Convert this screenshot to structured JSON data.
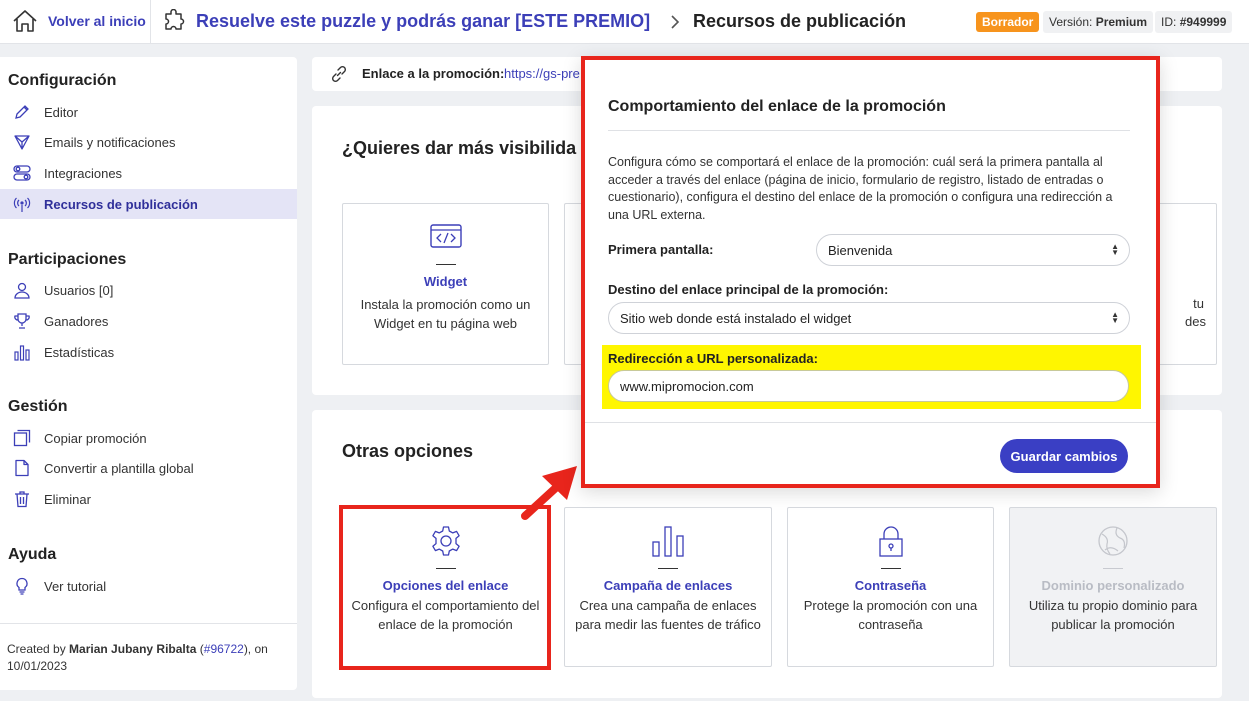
{
  "header": {
    "home_label": "Volver al inicio",
    "promo_title": "Resuelve este puzzle y podrás ganar [ESTE PREMIO]",
    "current_page": "Recursos de publicación",
    "status_badge": "Borrador",
    "version_label": "Versión:",
    "version_value": "Premium",
    "id_label": "ID:",
    "id_value": "#949999",
    "status_color": "#f7941d"
  },
  "sidebar": {
    "sections": [
      {
        "title": "Configuración",
        "items": [
          {
            "label": "Editor",
            "icon": "pencil-icon"
          },
          {
            "label": "Emails y notificaciones",
            "icon": "send-icon"
          },
          {
            "label": "Integraciones",
            "icon": "toggles-icon"
          },
          {
            "label": "Recursos de publicación",
            "icon": "broadcast-icon",
            "active": true
          }
        ]
      },
      {
        "title": "Participaciones",
        "items": [
          {
            "label": "Usuarios [0]",
            "icon": "user-icon"
          },
          {
            "label": "Ganadores",
            "icon": "trophy-icon"
          },
          {
            "label": "Estadísticas",
            "icon": "bar-chart-icon"
          }
        ]
      },
      {
        "title": "Gestión",
        "items": [
          {
            "label": "Copiar promoción",
            "icon": "copy-icon"
          },
          {
            "label": "Convertir a plantilla global",
            "icon": "document-icon"
          },
          {
            "label": "Eliminar",
            "icon": "trash-icon"
          }
        ]
      },
      {
        "title": "Ayuda",
        "items": [
          {
            "label": "Ver tutorial",
            "icon": "lightbulb-icon"
          }
        ]
      }
    ],
    "created_prefix": "Created by",
    "created_author": "Marian Jubany Ribalta",
    "created_id_open": "(",
    "created_id": "#96722",
    "created_suffix": "), on",
    "created_date": "10/01/2023"
  },
  "link_bar": {
    "label": "Enlace a la promoción:",
    "url": "https://gs-pre"
  },
  "visibility_panel": {
    "title": "¿Quieres dar más visibilida",
    "cards": [
      {
        "title": "Widget",
        "description": "Instala la promoción como un Widget en tu página web",
        "icon": "code-window-icon"
      }
    ],
    "partial_text_1": "tu",
    "partial_text_2": "des"
  },
  "other_panel": {
    "title": "Otras opciones",
    "cards": [
      {
        "title": "Opciones del enlace",
        "description": "Configura el comportamiento del enlace de la promoción",
        "icon": "gear-icon"
      },
      {
        "title": "Campaña de enlaces",
        "description": "Crea una campaña de enlaces para medir las fuentes de tráfico",
        "icon": "bar-chart-icon"
      },
      {
        "title": "Contraseña",
        "description": "Protege la promoción con una contraseña",
        "icon": "lock-icon"
      },
      {
        "title": "Dominio personalizado",
        "description": "Utiliza tu propio dominio para publicar la promoción",
        "icon": "globe-icon",
        "disabled": true
      }
    ]
  },
  "modal": {
    "title": "Comportamiento del enlace de la promoción",
    "description": "Configura cómo se comportará el enlace de la promoción: cuál será la primera pantalla al acceder a través del enlace (página de inicio, formulario de registro, listado de entradas o cuestionario), configura el destino del enlace de la promoción o configura una redirección a una URL externa.",
    "first_screen_label": "Primera pantalla:",
    "first_screen_value": "Bienvenida",
    "destination_label": "Destino del enlace principal de la promoción:",
    "destination_value": "Sitio web donde está instalado el widget",
    "redirect_label": "Redirección a URL personalizada:",
    "redirect_value": "www.mipromocion.com",
    "save_label": "Guardar cambios",
    "accent_color": "#3a3fc4",
    "highlight_color": "#fff600",
    "annotation_color": "#e8251c"
  }
}
